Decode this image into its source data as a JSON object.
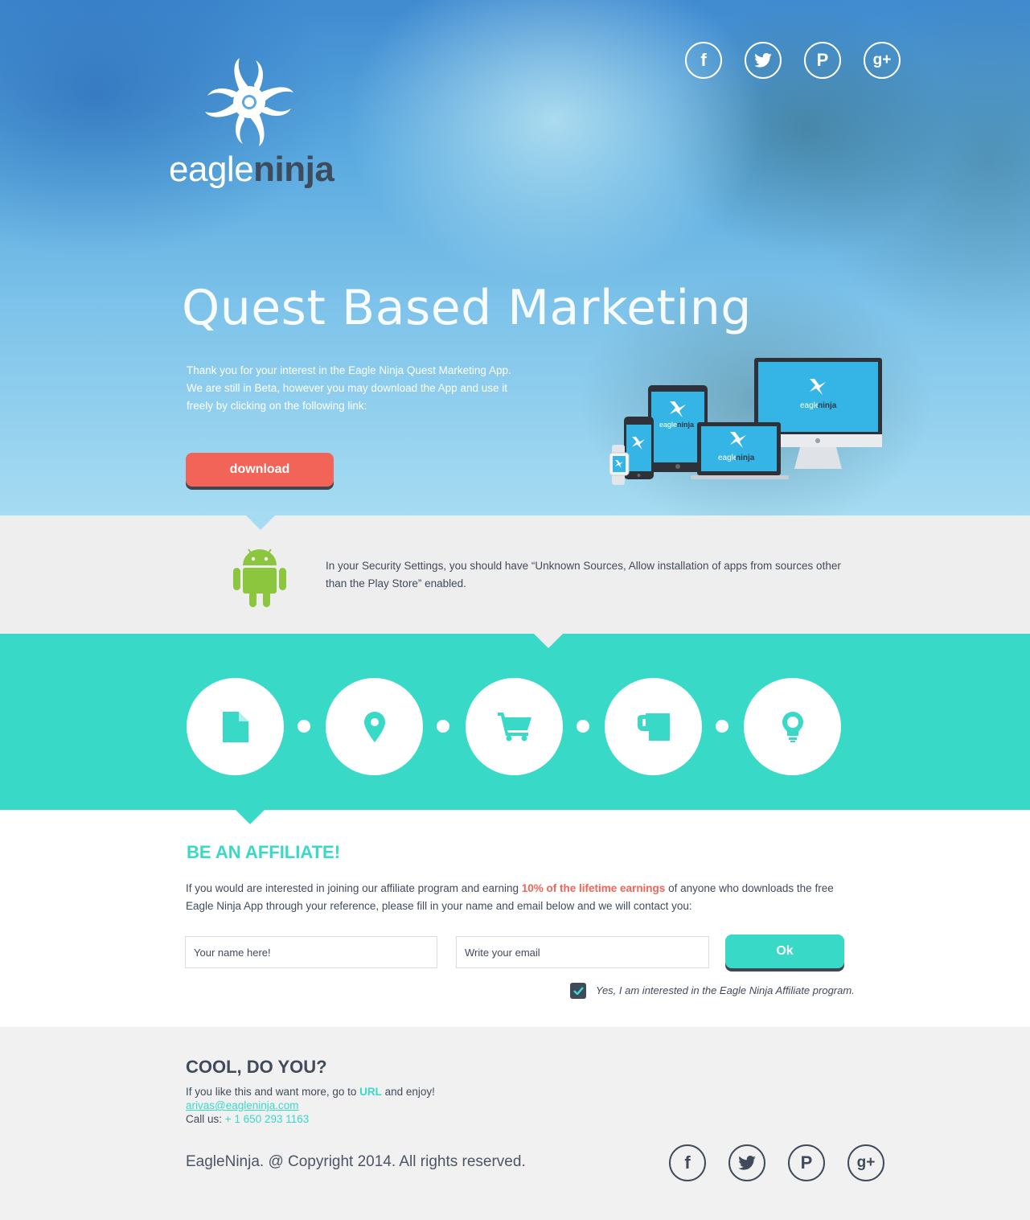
{
  "hero": {
    "brand_part1": "eagle",
    "brand_part2": "ninja",
    "title": "Quest Based Marketing",
    "text": "Thank you for your interest in the Eagle Ninja Quest Marketing App. We are still in Beta, however you may download the App and use it freely by clicking on the following link:",
    "download_label": "download",
    "device_brand_part1": "eagle",
    "device_brand_part2": "ninja"
  },
  "social": {
    "facebook": "f",
    "twitter": "twitter",
    "pinterest": "P",
    "googleplus": "g+"
  },
  "android": {
    "text": "In your Security Settings, you should have “Unknown Sources, Allow installation of apps from sources other than the Play Store” enabled."
  },
  "steps": [
    {
      "icon": "document-icon"
    },
    {
      "icon": "map-pin-icon"
    },
    {
      "icon": "shopping-cart-icon"
    },
    {
      "icon": "coffee-mug-icon"
    },
    {
      "icon": "lightbulb-icon"
    }
  ],
  "affiliate": {
    "title": "BE AN AFFILIATE!",
    "text_before": "If you would are interested in joining our affiliate program and earning ",
    "highlight": "10% of the lifetime earnings",
    "text_after": " of anyone who downloads the free Eagle Ninja App through your reference, please fill in your name and email below and we will contact you:",
    "name_placeholder": "Your name here!",
    "email_placeholder": "Write your email",
    "ok_label": "Ok",
    "checkbox_label": "Yes, I am interested in the Eagle Ninja Affiliate program.",
    "checkbox_checked": true
  },
  "footer": {
    "title": "COOL, DO YOU?",
    "line1_before": "If you like this and want more, go to ",
    "line1_link": "URL",
    "line1_after": " and enjoy!",
    "email": "arivas@eagleninja.com",
    "call_label": "Call us: ",
    "phone": "+ 1 650 293 1163",
    "copyright": "EagleNinja. @ Copyright 2014. All rights reserved."
  },
  "colors": {
    "teal": "#39d9c8",
    "coral": "#f26457",
    "dark": "#3f4b5b",
    "android_green": "#8cc63e"
  }
}
